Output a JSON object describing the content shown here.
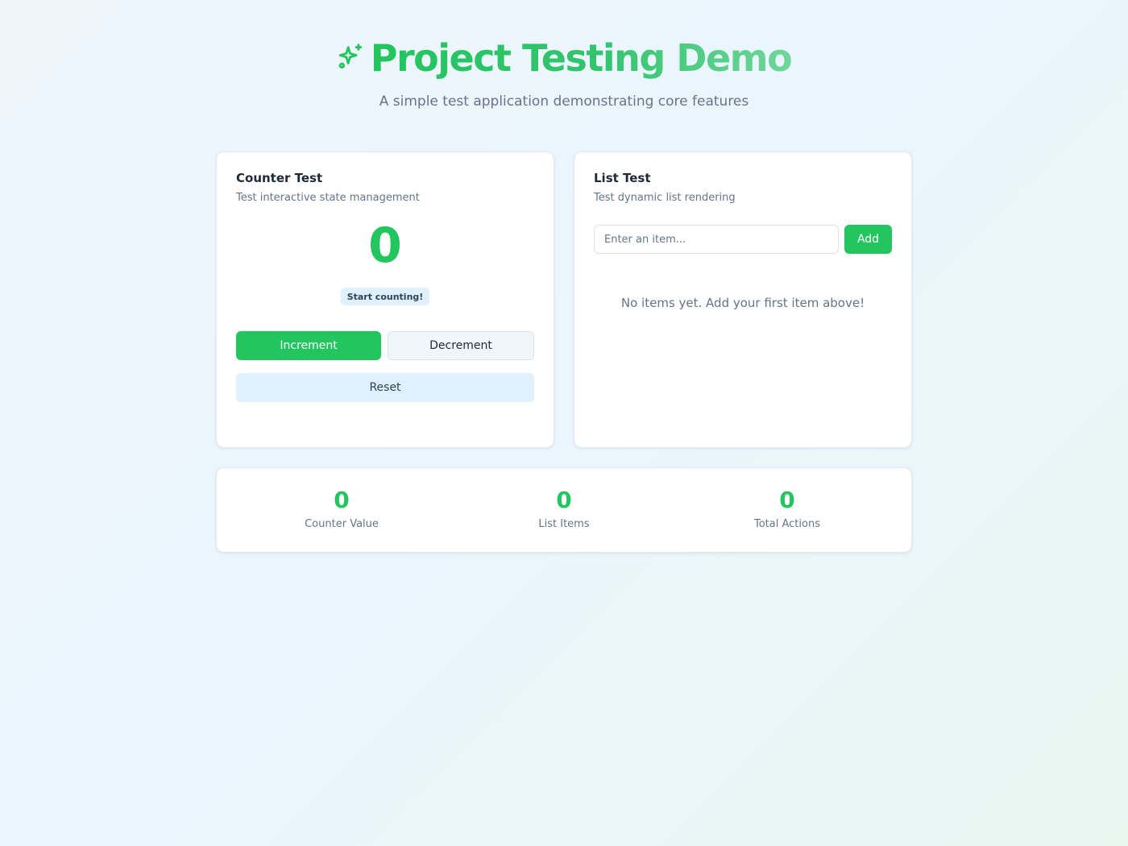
{
  "header": {
    "title": "Project Testing Demo",
    "subtitle": "A simple test application demonstrating core features",
    "icon": "sparkles-icon"
  },
  "counter": {
    "title": "Counter Test",
    "description": "Test interactive state management",
    "value": "0",
    "status_badge": "Start counting!",
    "increment_label": "Increment",
    "decrement_label": "Decrement",
    "reset_label": "Reset"
  },
  "list": {
    "title": "List Test",
    "description": "Test dynamic list rendering",
    "input_value": "",
    "input_placeholder": "Enter an item...",
    "add_label": "Add",
    "empty_message": "No items yet. Add your first item above!"
  },
  "stats": [
    {
      "value": "0",
      "label": "Counter Value"
    },
    {
      "value": "0",
      "label": "List Items"
    },
    {
      "value": "0",
      "label": "Total Actions"
    }
  ],
  "colors": {
    "accent": "#22c55e",
    "badge_bg": "#e0f0fc",
    "muted_text": "#64748b"
  }
}
